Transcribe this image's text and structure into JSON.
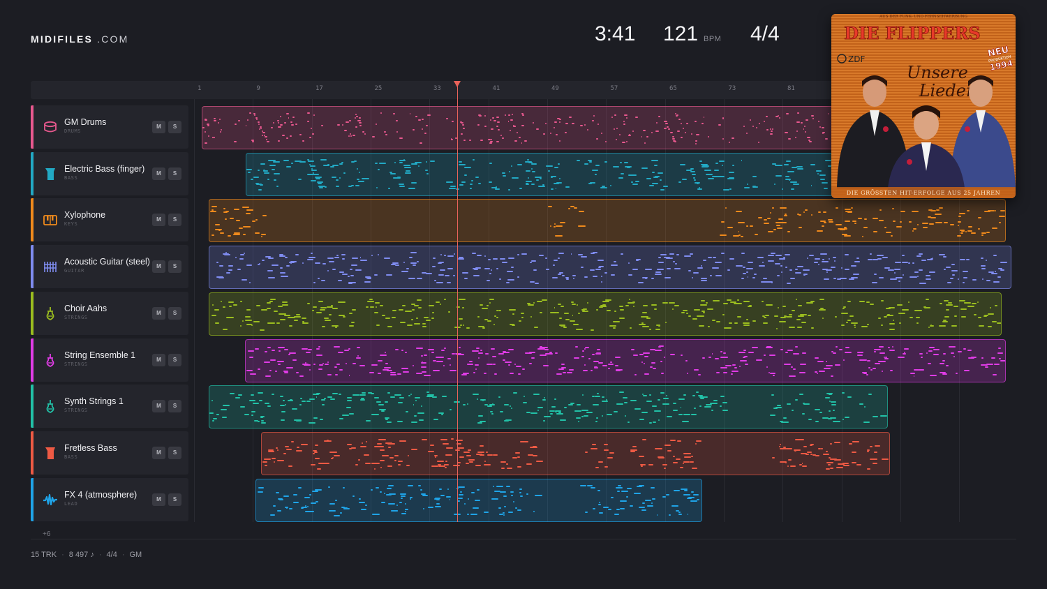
{
  "brand": {
    "strong": "MIDIFILES",
    "light": ".COM"
  },
  "transport": {
    "time": "3:41",
    "bpm": "121",
    "bpm_unit": "BPM",
    "signature": "4/4"
  },
  "ruler": {
    "bars": [
      "1",
      "9",
      "17",
      "25",
      "33",
      "41",
      "49",
      "57",
      "65",
      "73",
      "81"
    ]
  },
  "playhead": {
    "position_bar": 34
  },
  "tracks": [
    {
      "name": "GM Drums",
      "category": "DRUMS",
      "color": "#e8588e",
      "icon": "drum-icon",
      "mute": "M",
      "solo": "S"
    },
    {
      "name": "Electric Bass (finger)",
      "category": "BASS",
      "color": "#22a9c4",
      "icon": "bass-icon",
      "mute": "M",
      "solo": "S"
    },
    {
      "name": "Xylophone",
      "category": "KEYS",
      "color": "#f08a1c",
      "icon": "keys-icon",
      "mute": "M",
      "solo": "S"
    },
    {
      "name": "Acoustic Guitar (steel)",
      "category": "GUITAR",
      "color": "#7f8cf0",
      "icon": "guitar-icon",
      "mute": "M",
      "solo": "S"
    },
    {
      "name": "Choir Aahs",
      "category": "STRINGS",
      "color": "#9bbd1f",
      "icon": "strings-icon",
      "mute": "M",
      "solo": "S"
    },
    {
      "name": "String Ensemble 1",
      "category": "STRINGS",
      "color": "#e03ce6",
      "icon": "strings-icon",
      "mute": "M",
      "solo": "S"
    },
    {
      "name": "Synth Strings 1",
      "category": "STRINGS",
      "color": "#22c1a7",
      "icon": "strings-icon",
      "mute": "M",
      "solo": "S"
    },
    {
      "name": "Fretless Bass",
      "category": "BASS",
      "color": "#ee5a44",
      "icon": "bass-icon",
      "mute": "M",
      "solo": "S"
    },
    {
      "name": "FX 4 (atmosphere)",
      "category": "LEAD",
      "color": "#1fa4e8",
      "icon": "wave-icon",
      "mute": "M",
      "solo": "S"
    }
  ],
  "more_tracks": "+6",
  "footer": {
    "tracks": "15 TRK",
    "notes": "8 497 ♪",
    "signature": "4/4",
    "standard": "GM"
  },
  "album": {
    "top_line": "AUS DER FUNK- UND FERNSEHWERBUNG",
    "artist": "DIE FLIPPERS",
    "title_line1": "Unsere",
    "title_line2": "Lieder",
    "badge_line1": "NEU",
    "badge_line2": "PRODUKTION",
    "badge_line3": "1994",
    "network": "ZDF",
    "bottom_line": "DIE GRÖSSTEN HIT-ERFOLGE AUS 25 JAHREN"
  }
}
